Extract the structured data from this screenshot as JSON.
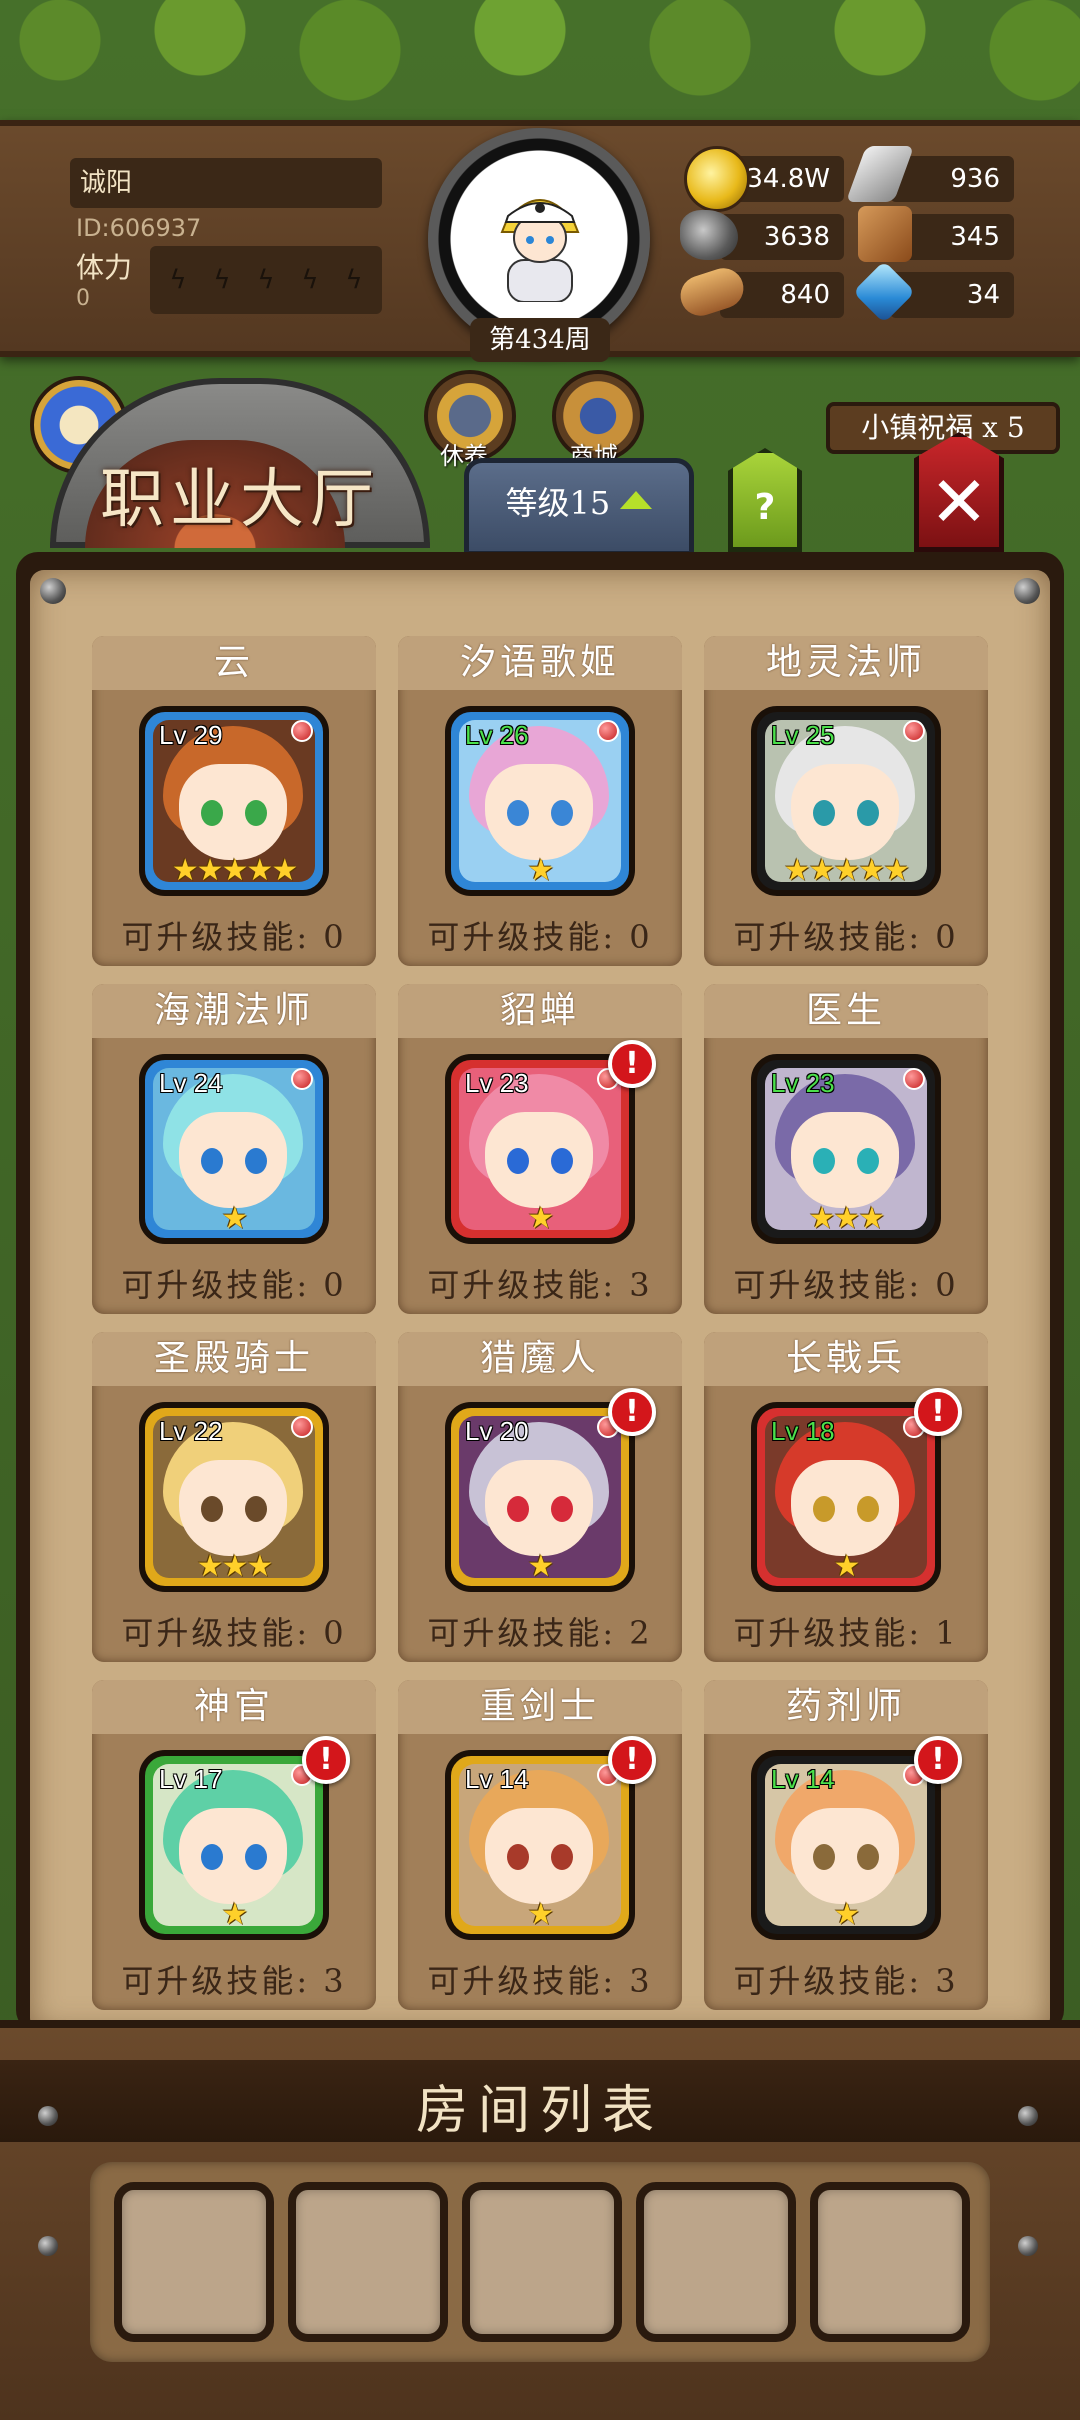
{
  "player": {
    "name": "诚阳",
    "id": "ID:606937",
    "stamina_label": "体力",
    "stamina_value": "0",
    "week": "第434周"
  },
  "resources": [
    {
      "name": "gold-coin-icon",
      "value": "34.8W"
    },
    {
      "name": "iron-ingot-icon",
      "value": "936"
    },
    {
      "name": "stone-icon",
      "value": "3638"
    },
    {
      "name": "leather-icon",
      "value": "345"
    },
    {
      "name": "wood-log-icon",
      "value": "840"
    },
    {
      "name": "crystal-icon",
      "value": "34"
    }
  ],
  "nav": {
    "hall_title": "职业大厅",
    "rest_label": "休养",
    "shop_label": "商城",
    "level_label": "等级15",
    "help_label": "?",
    "close_label": "✕",
    "blessing_label": "小镇祝福 x 5"
  },
  "jobs": [
    {
      "title": "云",
      "level": "Lv 29",
      "stars": "★★★★★",
      "skills": "可升级技能: 0",
      "alert": false,
      "lv_color": "#ffffff",
      "frame": "#2f86d6",
      "hair": "#c8682a",
      "bg": "#6a3a22",
      "eye": "#3aa84a"
    },
    {
      "title": "汐语歌姬",
      "level": "Lv 26",
      "stars": "★",
      "skills": "可升级技能: 0",
      "alert": false,
      "lv_color": "#4be04b",
      "frame": "#2f86d6",
      "hair": "#e8a6d6",
      "bg": "#9ad0f2",
      "eye": "#3a86d6"
    },
    {
      "title": "地灵法师",
      "level": "Lv 25",
      "stars": "★★★★★",
      "skills": "可升级技能: 0",
      "alert": false,
      "lv_color": "#4be04b",
      "frame": "#1a1a1a",
      "hair": "#e6e6e6",
      "bg": "#b9c2b0",
      "eye": "#2a9aa8"
    },
    {
      "title": "海潮法师",
      "level": "Lv 24",
      "stars": "★",
      "skills": "可升级技能: 0",
      "alert": false,
      "lv_color": "#ffffff",
      "frame": "#2f86d6",
      "hair": "#8fe2e6",
      "bg": "#6ab8e0",
      "eye": "#2a7ad0"
    },
    {
      "title": "貂蝉",
      "level": "Lv 23",
      "stars": "★",
      "skills": "可升级技能: 3",
      "alert": true,
      "lv_color": "#ffffff",
      "frame": "#d6302f",
      "hair": "#f08aa6",
      "bg": "#e8607a",
      "eye": "#2a6ad6"
    },
    {
      "title": "医生",
      "level": "Lv 23",
      "stars": "★★★",
      "skills": "可升级技能: 0",
      "alert": false,
      "lv_color": "#4be04b",
      "frame": "#1a1a1a",
      "hair": "#7a6aa8",
      "bg": "#c0b6cf",
      "eye": "#2ab0b6"
    },
    {
      "title": "圣殿骑士",
      "level": "Lv 22",
      "stars": "★★★",
      "skills": "可升级技能: 0",
      "alert": false,
      "lv_color": "#ffffff",
      "frame": "#e0a81a",
      "hair": "#f0d07a",
      "bg": "#8a6a3a",
      "eye": "#6a4a2a"
    },
    {
      "title": "猎魔人",
      "level": "Lv 20",
      "stars": "★",
      "skills": "可升级技能: 2",
      "alert": true,
      "lv_color": "#ffffff",
      "frame": "#e0a81a",
      "hair": "#c8c2d6",
      "bg": "#6a3a6a",
      "eye": "#d62a3a"
    },
    {
      "title": "长戟兵",
      "level": "Lv 18",
      "stars": "★",
      "skills": "可升级技能: 1",
      "alert": true,
      "lv_color": "#4be04b",
      "frame": "#d6302f",
      "hair": "#d63a2a",
      "bg": "#7a3a2a",
      "eye": "#c89a2a"
    },
    {
      "title": "神官",
      "level": "Lv 17",
      "stars": "★",
      "skills": "可升级技能: 3",
      "alert": true,
      "lv_color": "#ffffff",
      "frame": "#3aa83a",
      "hair": "#5ed0a6",
      "bg": "#d6e6c6",
      "eye": "#2a7ad0"
    },
    {
      "title": "重剑士",
      "level": "Lv 14",
      "stars": "★",
      "skills": "可升级技能: 3",
      "alert": true,
      "lv_color": "#ffffff",
      "frame": "#e0a81a",
      "hair": "#e8a85a",
      "bg": "#c8a67a",
      "eye": "#a83a2a"
    },
    {
      "title": "药剂师",
      "level": "Lv 14",
      "stars": "★",
      "skills": "可升级技能: 3",
      "alert": true,
      "lv_color": "#4be04b",
      "frame": "#1a1a1a",
      "hair": "#f0a86a",
      "bg": "#d6c6a6",
      "eye": "#8a6a3a"
    }
  ],
  "alert_mark": "!",
  "room": {
    "title": "房间列表",
    "slot_count": 5
  }
}
